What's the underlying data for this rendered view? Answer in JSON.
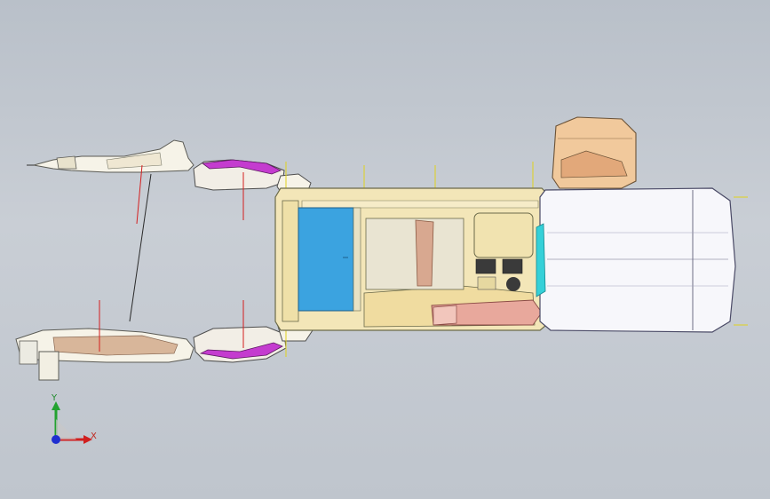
{
  "viewport": {
    "background_top": "#b9c0c9",
    "background_bottom": "#bfc5cd"
  },
  "model": {
    "colors": {
      "body_cream": "#f3e6b8",
      "body_outline": "#6b6a4a",
      "panel_blue": "#3ba3e0",
      "cab_white": "#f7f7fb",
      "cab_outline": "#4a4a66",
      "cyan_accent": "#35d0d8",
      "magenta_accent": "#c43ccf",
      "copper_accent": "#d39a7a",
      "reference_line": "#d41e1e",
      "guide_line": "#e0d21c"
    }
  },
  "triad": {
    "x_label": "X",
    "y_label": "Y",
    "x_color": "#d01f1f",
    "y_color": "#23a230",
    "z_color": "#1f2fd0"
  }
}
